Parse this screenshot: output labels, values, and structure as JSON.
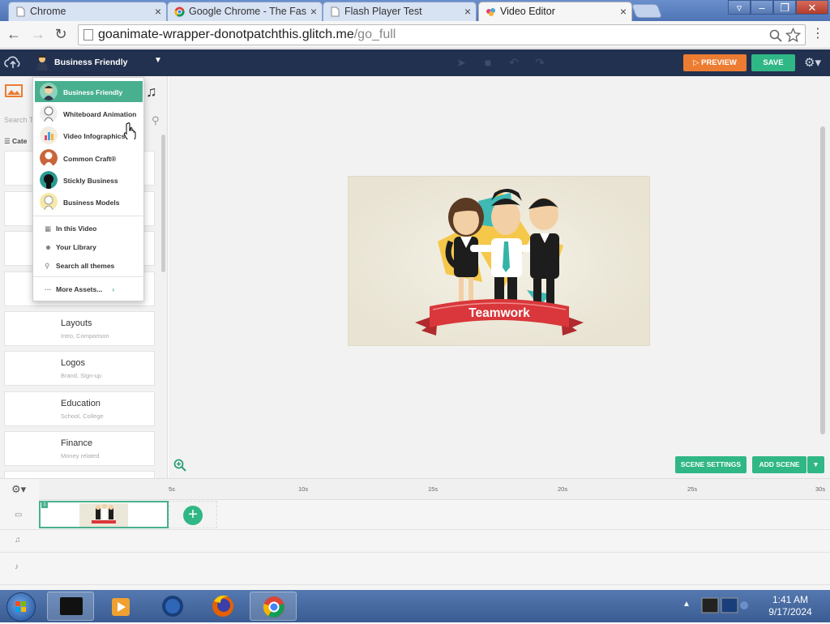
{
  "browser": {
    "tabs": [
      {
        "title": "Chrome",
        "active": false
      },
      {
        "title": "Google Chrome - The Fas",
        "active": false
      },
      {
        "title": "Flash Player Test",
        "active": false
      },
      {
        "title": "Video Editor",
        "active": true
      }
    ],
    "close_glyph": "×",
    "url_host": "goanimate-wrapper-donotpatchthis.glitch.me",
    "url_path": "/go_full"
  },
  "header": {
    "theme_label": "Business Friendly",
    "preview_label": "PREVIEW",
    "save_label": "SAVE"
  },
  "theme_dropdown": {
    "themes": [
      {
        "label": "Business Friendly",
        "selected": true
      },
      {
        "label": "Whiteboard Animation",
        "selected": false
      },
      {
        "label": "Video Infographics",
        "selected": false
      },
      {
        "label": "Common Craft®",
        "selected": false
      },
      {
        "label": "Stickly Business",
        "selected": false
      },
      {
        "label": "Business Models",
        "selected": false
      }
    ],
    "links": [
      {
        "label": "In this Video",
        "icon": "film-icon"
      },
      {
        "label": "Your Library",
        "icon": "user-icon"
      },
      {
        "label": "Search all themes",
        "icon": "search-icon"
      }
    ],
    "more_label": "More Assets..."
  },
  "asset_panel": {
    "search_placeholder": "Search Th",
    "categories_label": "Cate",
    "cards": [
      {
        "title": "Layouts",
        "subtitle": "Intro, Comparison"
      },
      {
        "title": "Logos",
        "subtitle": "Brand, Sign-up"
      },
      {
        "title": "Education",
        "subtitle": "School, College"
      },
      {
        "title": "Finance",
        "subtitle": "Money related"
      }
    ]
  },
  "canvas": {
    "banner_text": "Teamwork"
  },
  "scene_buttons": {
    "scene_settings": "SCENE SETTINGS",
    "add_scene": "ADD SCENE"
  },
  "timeline": {
    "ticks": [
      "5s",
      "10s",
      "15s",
      "20s",
      "25s",
      "30s"
    ],
    "scene_number": "1"
  },
  "taskbar": {
    "time": "1:41 AM",
    "date": "9/17/2024"
  },
  "colors": {
    "header_bg": "#22314f",
    "preview": "#ec7c32",
    "save": "#30b786",
    "selected_theme": "#49b08f",
    "banner_red": "#d9373b"
  }
}
